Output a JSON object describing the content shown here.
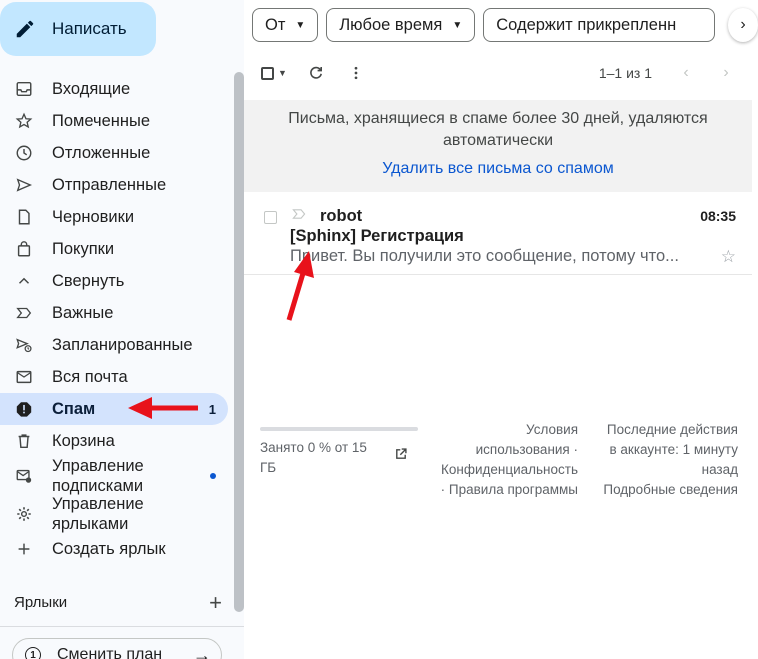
{
  "compose": {
    "label": "Написать"
  },
  "nav": [
    {
      "label": "Входящие",
      "icon": "inbox-icon"
    },
    {
      "label": "Помеченные",
      "icon": "star-icon"
    },
    {
      "label": "Отложенные",
      "icon": "clock-icon"
    },
    {
      "label": "Отправленные",
      "icon": "send-icon"
    },
    {
      "label": "Черновики",
      "icon": "draft-icon"
    },
    {
      "label": "Покупки",
      "icon": "bag-icon"
    },
    {
      "label": "Свернуть",
      "icon": "chevron-up-icon"
    },
    {
      "label": "Важные",
      "icon": "important-icon"
    },
    {
      "label": "Запланированные",
      "icon": "scheduled-icon"
    },
    {
      "label": "Вся почта",
      "icon": "all-mail-icon"
    },
    {
      "label": "Спам",
      "icon": "spam-icon",
      "count": "1"
    },
    {
      "label": "Корзина",
      "icon": "trash-icon"
    },
    {
      "label_line1": "Управление",
      "label_line2": "подписками",
      "icon": "subscriptions-icon"
    },
    {
      "label_line1": "Управление",
      "label_line2": "ярлыками",
      "icon": "gear-icon"
    },
    {
      "label": "Создать ярлык",
      "icon": "plus-icon"
    }
  ],
  "labels": {
    "title": "Ярлыки"
  },
  "plan": {
    "label": "Сменить план",
    "badge": "1"
  },
  "filters": {
    "from": "От",
    "time": "Любое время",
    "attachment": "Содержит прикрепленн"
  },
  "toolbar": {
    "pager": "1–1 из 1"
  },
  "banner": {
    "text": "Письма, хранящиеся в спаме более 30 дней, удаляются автоматически",
    "action": "Удалить все письма со спамом"
  },
  "emails": [
    {
      "sender": "robot",
      "time": "08:35",
      "subject": "[Sphinx] Регистрация",
      "snippet": "Привет. Вы получили это сообщение, потому что..."
    }
  ],
  "footer": {
    "storage": "Занято 0 % от 15 ГБ",
    "storage_fraction": 0,
    "terms_1": "Условия",
    "terms_2": "использования ·",
    "terms_3": "Конфиденциальность",
    "terms_4": "· Правила программы",
    "activity_1": "Последние действия",
    "activity_2": "в аккаунте: 1 минуту",
    "activity_3": "назад",
    "activity_4": "Подробные сведения"
  },
  "colors": {
    "accent": "#0b57d0",
    "active_bg": "#d3e3fd",
    "compose_bg": "#c2e7ff",
    "annotation": "#e8121b"
  }
}
